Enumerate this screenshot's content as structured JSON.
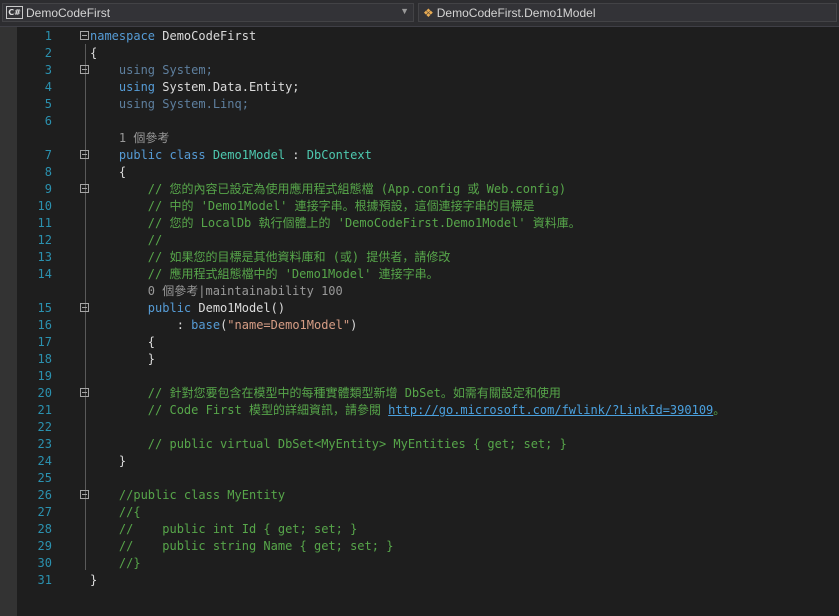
{
  "nav": {
    "project_icon": "C#",
    "project": "DemoCodeFirst",
    "member_icon": "class-icon",
    "member": "DemoCodeFirst.Demo1Model"
  },
  "colors": {
    "keyword": "#569cd6",
    "type": "#4ec9b0",
    "comment": "#57a64a",
    "string": "#d69d85",
    "line_number": "#2b91af",
    "background": "#1e1e1e"
  },
  "lines": [
    {
      "n": "1",
      "fold": true,
      "segs": [
        [
          "kw",
          "namespace"
        ],
        [
          "plain",
          " DemoCodeFirst"
        ]
      ]
    },
    {
      "n": "2",
      "fold": false,
      "segs": [
        [
          "plain",
          "{"
        ]
      ]
    },
    {
      "n": "3",
      "fold": true,
      "segs": [
        [
          "dim",
          "    using"
        ],
        [
          "dim",
          " System;"
        ]
      ]
    },
    {
      "n": "4",
      "fold": false,
      "segs": [
        [
          "kw",
          "    using"
        ],
        [
          "plain",
          " System.Data.Entity;"
        ]
      ]
    },
    {
      "n": "5",
      "fold": false,
      "segs": [
        [
          "dim",
          "    using"
        ],
        [
          "dim",
          " System.Linq;"
        ]
      ]
    },
    {
      "n": "6",
      "fold": false,
      "segs": []
    },
    {
      "lens": true,
      "segs": [
        [
          "lens",
          "    1 個參考"
        ]
      ]
    },
    {
      "n": "7",
      "fold": true,
      "segs": [
        [
          "kw",
          "    public class"
        ],
        [
          "plain",
          " "
        ],
        [
          "ty",
          "Demo1Model"
        ],
        [
          "plain",
          " : "
        ],
        [
          "ty",
          "DbContext"
        ]
      ]
    },
    {
      "n": "8",
      "fold": false,
      "segs": [
        [
          "plain",
          "    {"
        ]
      ]
    },
    {
      "n": "9",
      "fold": true,
      "segs": [
        [
          "cm",
          "        // 您的內容已設定為使用應用程式組態檔 (App.config 或 Web.config)"
        ]
      ]
    },
    {
      "n": "10",
      "fold": false,
      "segs": [
        [
          "cm",
          "        // 中的 'Demo1Model' 連接字串。根據預設，這個連接字串的目標是"
        ]
      ]
    },
    {
      "n": "11",
      "fold": false,
      "segs": [
        [
          "cm",
          "        // 您的 LocalDb 執行個體上的 'DemoCodeFirst.Demo1Model' 資料庫。"
        ]
      ]
    },
    {
      "n": "12",
      "fold": false,
      "segs": [
        [
          "cm",
          "        //"
        ]
      ]
    },
    {
      "n": "13",
      "fold": false,
      "segs": [
        [
          "cm",
          "        // 如果您的目標是其他資料庫和 (或) 提供者，請修改"
        ]
      ]
    },
    {
      "n": "14",
      "fold": false,
      "segs": [
        [
          "cm",
          "        // 應用程式組態檔中的 'Demo1Model' 連接字串。"
        ]
      ]
    },
    {
      "lens": true,
      "segs": [
        [
          "lens",
          "        0 個參考|maintainability 100"
        ]
      ]
    },
    {
      "n": "15",
      "fold": true,
      "segs": [
        [
          "kw",
          "        public"
        ],
        [
          "plain",
          " Demo1Model()"
        ]
      ]
    },
    {
      "n": "16",
      "fold": false,
      "segs": [
        [
          "plain",
          "            : "
        ],
        [
          "kw",
          "base"
        ],
        [
          "plain",
          "("
        ],
        [
          "st",
          "\"name=Demo1Model\""
        ],
        [
          "plain",
          ")"
        ]
      ]
    },
    {
      "n": "17",
      "fold": false,
      "segs": [
        [
          "plain",
          "        {"
        ]
      ]
    },
    {
      "n": "18",
      "fold": false,
      "segs": [
        [
          "plain",
          "        }"
        ]
      ]
    },
    {
      "n": "19",
      "fold": false,
      "segs": []
    },
    {
      "n": "20",
      "fold": true,
      "segs": [
        [
          "cm",
          "        // 針對您要包含在模型中的每種實體類型新增 DbSet。如需有關設定和使用"
        ]
      ]
    },
    {
      "n": "21",
      "fold": false,
      "segs": [
        [
          "cm",
          "        // Code First 模型的詳細資訊，請參閱 "
        ],
        [
          "lk",
          "http://go.microsoft.com/fwlink/?LinkId=390109"
        ],
        [
          "cm",
          "。"
        ]
      ]
    },
    {
      "n": "22",
      "fold": false,
      "segs": []
    },
    {
      "n": "23",
      "fold": false,
      "segs": [
        [
          "cm",
          "        // public virtual DbSet<MyEntity> MyEntities { get; set; }"
        ]
      ]
    },
    {
      "n": "24",
      "fold": false,
      "segs": [
        [
          "plain",
          "    }"
        ]
      ]
    },
    {
      "n": "25",
      "fold": false,
      "segs": []
    },
    {
      "n": "26",
      "fold": true,
      "segs": [
        [
          "cm",
          "    //public class MyEntity"
        ]
      ]
    },
    {
      "n": "27",
      "fold": false,
      "segs": [
        [
          "cm",
          "    //{"
        ]
      ]
    },
    {
      "n": "28",
      "fold": false,
      "segs": [
        [
          "cm",
          "    //    public int Id { get; set; }"
        ]
      ]
    },
    {
      "n": "29",
      "fold": false,
      "segs": [
        [
          "cm",
          "    //    public string Name { get; set; }"
        ]
      ]
    },
    {
      "n": "30",
      "fold": false,
      "segs": [
        [
          "cm",
          "    //}"
        ]
      ]
    },
    {
      "n": "31",
      "fold": false,
      "segs": [
        [
          "plain",
          "}"
        ]
      ]
    }
  ]
}
